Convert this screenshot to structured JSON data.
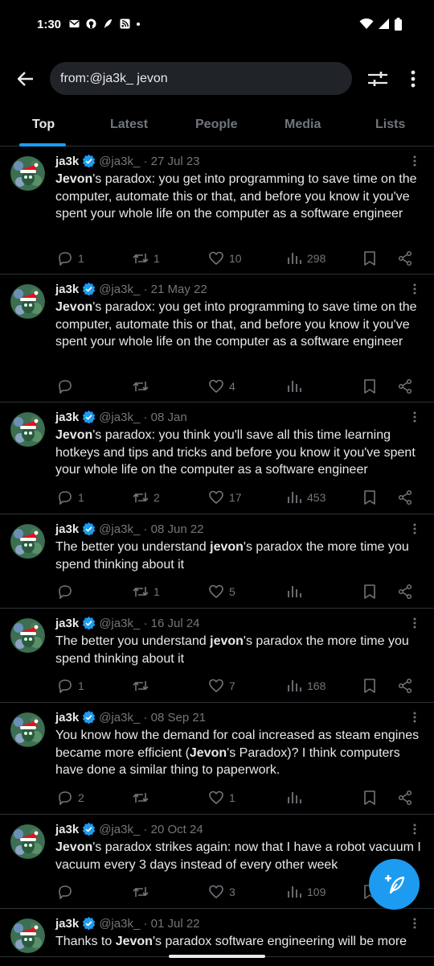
{
  "status": {
    "time": "1:30"
  },
  "search": {
    "query": "from:@ja3k_ jevon"
  },
  "tabs": [
    "Top",
    "Latest",
    "People",
    "Media",
    "Lists"
  ],
  "colors": {
    "accent": "#1d9bf0",
    "background": "#000000",
    "muted": "#71767b"
  },
  "tweets": [
    {
      "name": "ja3k",
      "handle": "@ja3k_",
      "date": "· 27 Jul 23",
      "text_parts": [
        [
          "Jevon",
          true
        ],
        [
          "'s paradox: you get into programming to save time on the computer, automate this or that, and before you know it you've spent your whole life on the computer as a software engineer",
          false
        ]
      ],
      "replies": "1",
      "retweets": "1",
      "likes": "10",
      "views": "298"
    },
    {
      "name": "ja3k",
      "handle": "@ja3k_",
      "date": "· 21 May 22",
      "text_parts": [
        [
          "Jevon",
          true
        ],
        [
          "'s paradox: you get into programming to save time on the computer, automate this or that, and before you know it you've spent your whole life on the computer as a software engineer",
          false
        ]
      ],
      "replies": "",
      "retweets": "",
      "likes": "4",
      "views": ""
    },
    {
      "name": "ja3k",
      "handle": "@ja3k_",
      "date": "· 08 Jan",
      "text_parts": [
        [
          "Jevon",
          true
        ],
        [
          "'s paradox: you think you'll save all this time learning hotkeys and tips and tricks and before you know it you've spent your whole life on the computer as a software engineer",
          false
        ]
      ],
      "replies": "1",
      "retweets": "2",
      "likes": "17",
      "views": "453"
    },
    {
      "name": "ja3k",
      "handle": "@ja3k_",
      "date": "· 08 Jun 22",
      "text_parts": [
        [
          "The better you understand ",
          false
        ],
        [
          "jevon",
          true
        ],
        [
          "'s paradox the more time you spend thinking about it",
          false
        ]
      ],
      "replies": "",
      "retweets": "1",
      "likes": "5",
      "views": ""
    },
    {
      "name": "ja3k",
      "handle": "@ja3k_",
      "date": "· 16 Jul 24",
      "text_parts": [
        [
          "The better you understand ",
          false
        ],
        [
          "jevon",
          true
        ],
        [
          "'s paradox the more time you spend thinking about it",
          false
        ]
      ],
      "replies": "1",
      "retweets": "",
      "likes": "7",
      "views": "168"
    },
    {
      "name": "ja3k",
      "handle": "@ja3k_",
      "date": "· 08 Sep 21",
      "text_parts": [
        [
          "You know how the demand for coal increased as steam engines became more efficient (",
          false
        ],
        [
          "Jevon",
          true
        ],
        [
          "'s Paradox)? I think computers have done a similar thing to paperwork.",
          false
        ]
      ],
      "replies": "2",
      "retweets": "",
      "likes": "1",
      "views": ""
    },
    {
      "name": "ja3k",
      "handle": "@ja3k_",
      "date": "· 20 Oct 24",
      "text_parts": [
        [
          "Jevon",
          true
        ],
        [
          "'s paradox strikes again: now that I have a robot  vacuum I vacuum every 3 days instead of every other week",
          false
        ]
      ],
      "replies": "",
      "retweets": "",
      "likes": "3",
      "views": "109"
    },
    {
      "name": "ja3k",
      "handle": "@ja3k_",
      "date": "· 01 Jul 22",
      "text_parts": [
        [
          "Thanks to ",
          false
        ],
        [
          "Jevon",
          true
        ],
        [
          "'s paradox software engineering will be more",
          false
        ]
      ],
      "replies": "",
      "retweets": "",
      "likes": "",
      "views": ""
    }
  ]
}
